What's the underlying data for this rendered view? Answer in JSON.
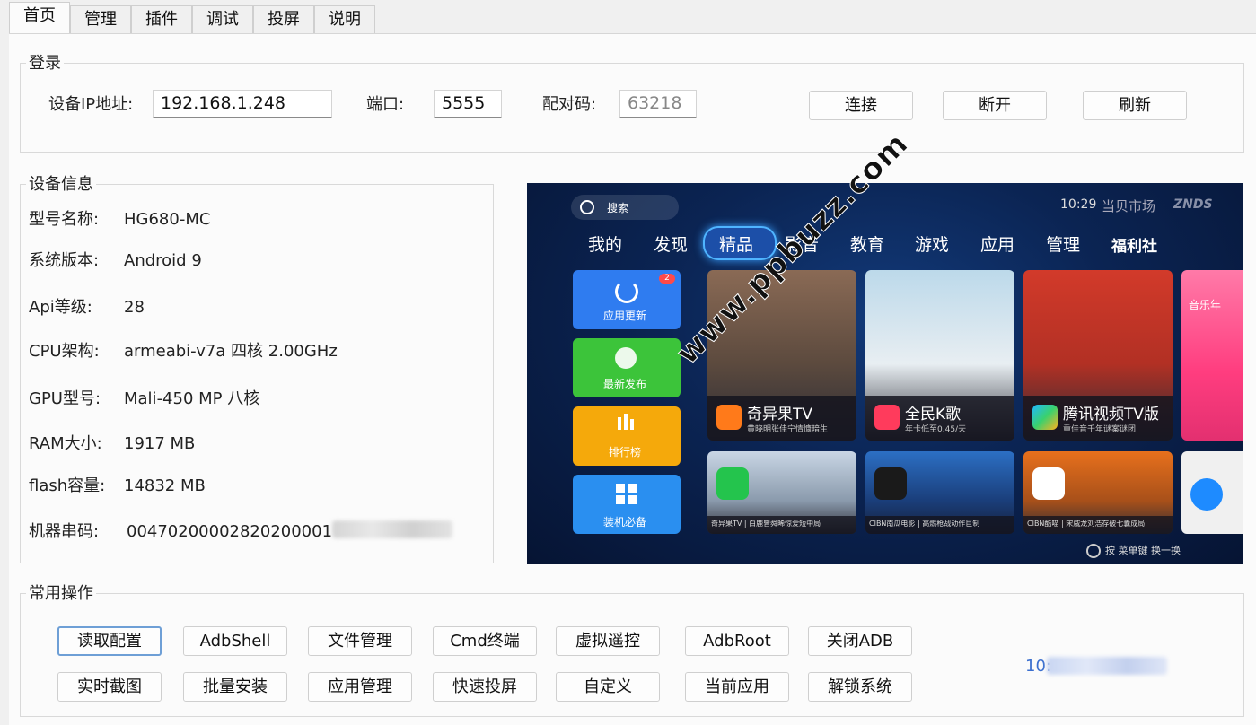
{
  "tabs": [
    "首页",
    "管理",
    "插件",
    "调试",
    "投屏",
    "说明"
  ],
  "login": {
    "title": "登录",
    "ip_label": "设备IP地址:",
    "ip_value": "192.168.1.248",
    "port_label": "端口:",
    "port_value": "5555",
    "pair_label": "配对码:",
    "pair_placeholder": "63218",
    "connect": "连接",
    "disconnect": "断开",
    "refresh": "刷新"
  },
  "device": {
    "title": "设备信息",
    "rows": [
      {
        "label": "型号名称:",
        "value": "HG680-MC"
      },
      {
        "label": "系统版本:",
        "value": "Android 9"
      },
      {
        "label": "Api等级:",
        "value": "28"
      },
      {
        "label": "CPU架构:",
        "value": "armeabi-v7a 四核 2.00GHz"
      },
      {
        "label": "GPU型号:",
        "value": "Mali-450 MP 八核"
      },
      {
        "label": "RAM大小:",
        "value": "1917 MB"
      },
      {
        "label": "flash容量:",
        "value": "14832 MB"
      },
      {
        "label": "机器串码:",
        "value": "00470200002820200001"
      }
    ]
  },
  "tv": {
    "search": "搜索",
    "time": "10:29",
    "brand": "当贝市场",
    "brand2": "ZNDS",
    "nav": [
      "我的",
      "发现",
      "精品",
      "影音",
      "教育",
      "游戏",
      "应用",
      "管理",
      "福利社"
    ],
    "left_tiles": [
      {
        "label": "应用更新",
        "color": "#2f7cf0",
        "badge": "2"
      },
      {
        "label": "最新发布",
        "color": "#3cc43a"
      },
      {
        "label": "排行榜",
        "color": "#f5a90b"
      },
      {
        "label": "装机必备",
        "color": "#2a8ff0"
      }
    ],
    "cards": [
      {
        "title": "奇异果TV",
        "sub": "黄晓明张佳宁情慷暗生"
      },
      {
        "title": "全民K歌",
        "sub": "年卡低至0.45/天"
      },
      {
        "title": "腾讯视频TV版",
        "sub": "重佳音千年谜案谜团"
      },
      {
        "title": "音乐年",
        "sub": ""
      }
    ],
    "bottom_cards": [
      {
        "caption": "奇异果TV | 白鹿曾舜晞惊爱短中局"
      },
      {
        "caption": "CIBN南瓜电影 | 高燃枪战动作巨制"
      },
      {
        "caption": "CIBN酷喵 | 宋威龙刘浩存破七囊成局"
      }
    ],
    "hint": "按 菜单键 换一换"
  },
  "watermark": "www.ppbuzz.com",
  "ops": {
    "title": "常用操作",
    "row1": [
      "读取配置",
      "AdbShell",
      "文件管理",
      "Cmd终端",
      "虚拟遥控",
      "AdbRoot",
      "关闭ADB"
    ],
    "row2": [
      "实时截图",
      "批量安装",
      "应用管理",
      "快速投屏",
      "自定义",
      "当前应用",
      "解锁系统"
    ],
    "status": "10:"
  }
}
